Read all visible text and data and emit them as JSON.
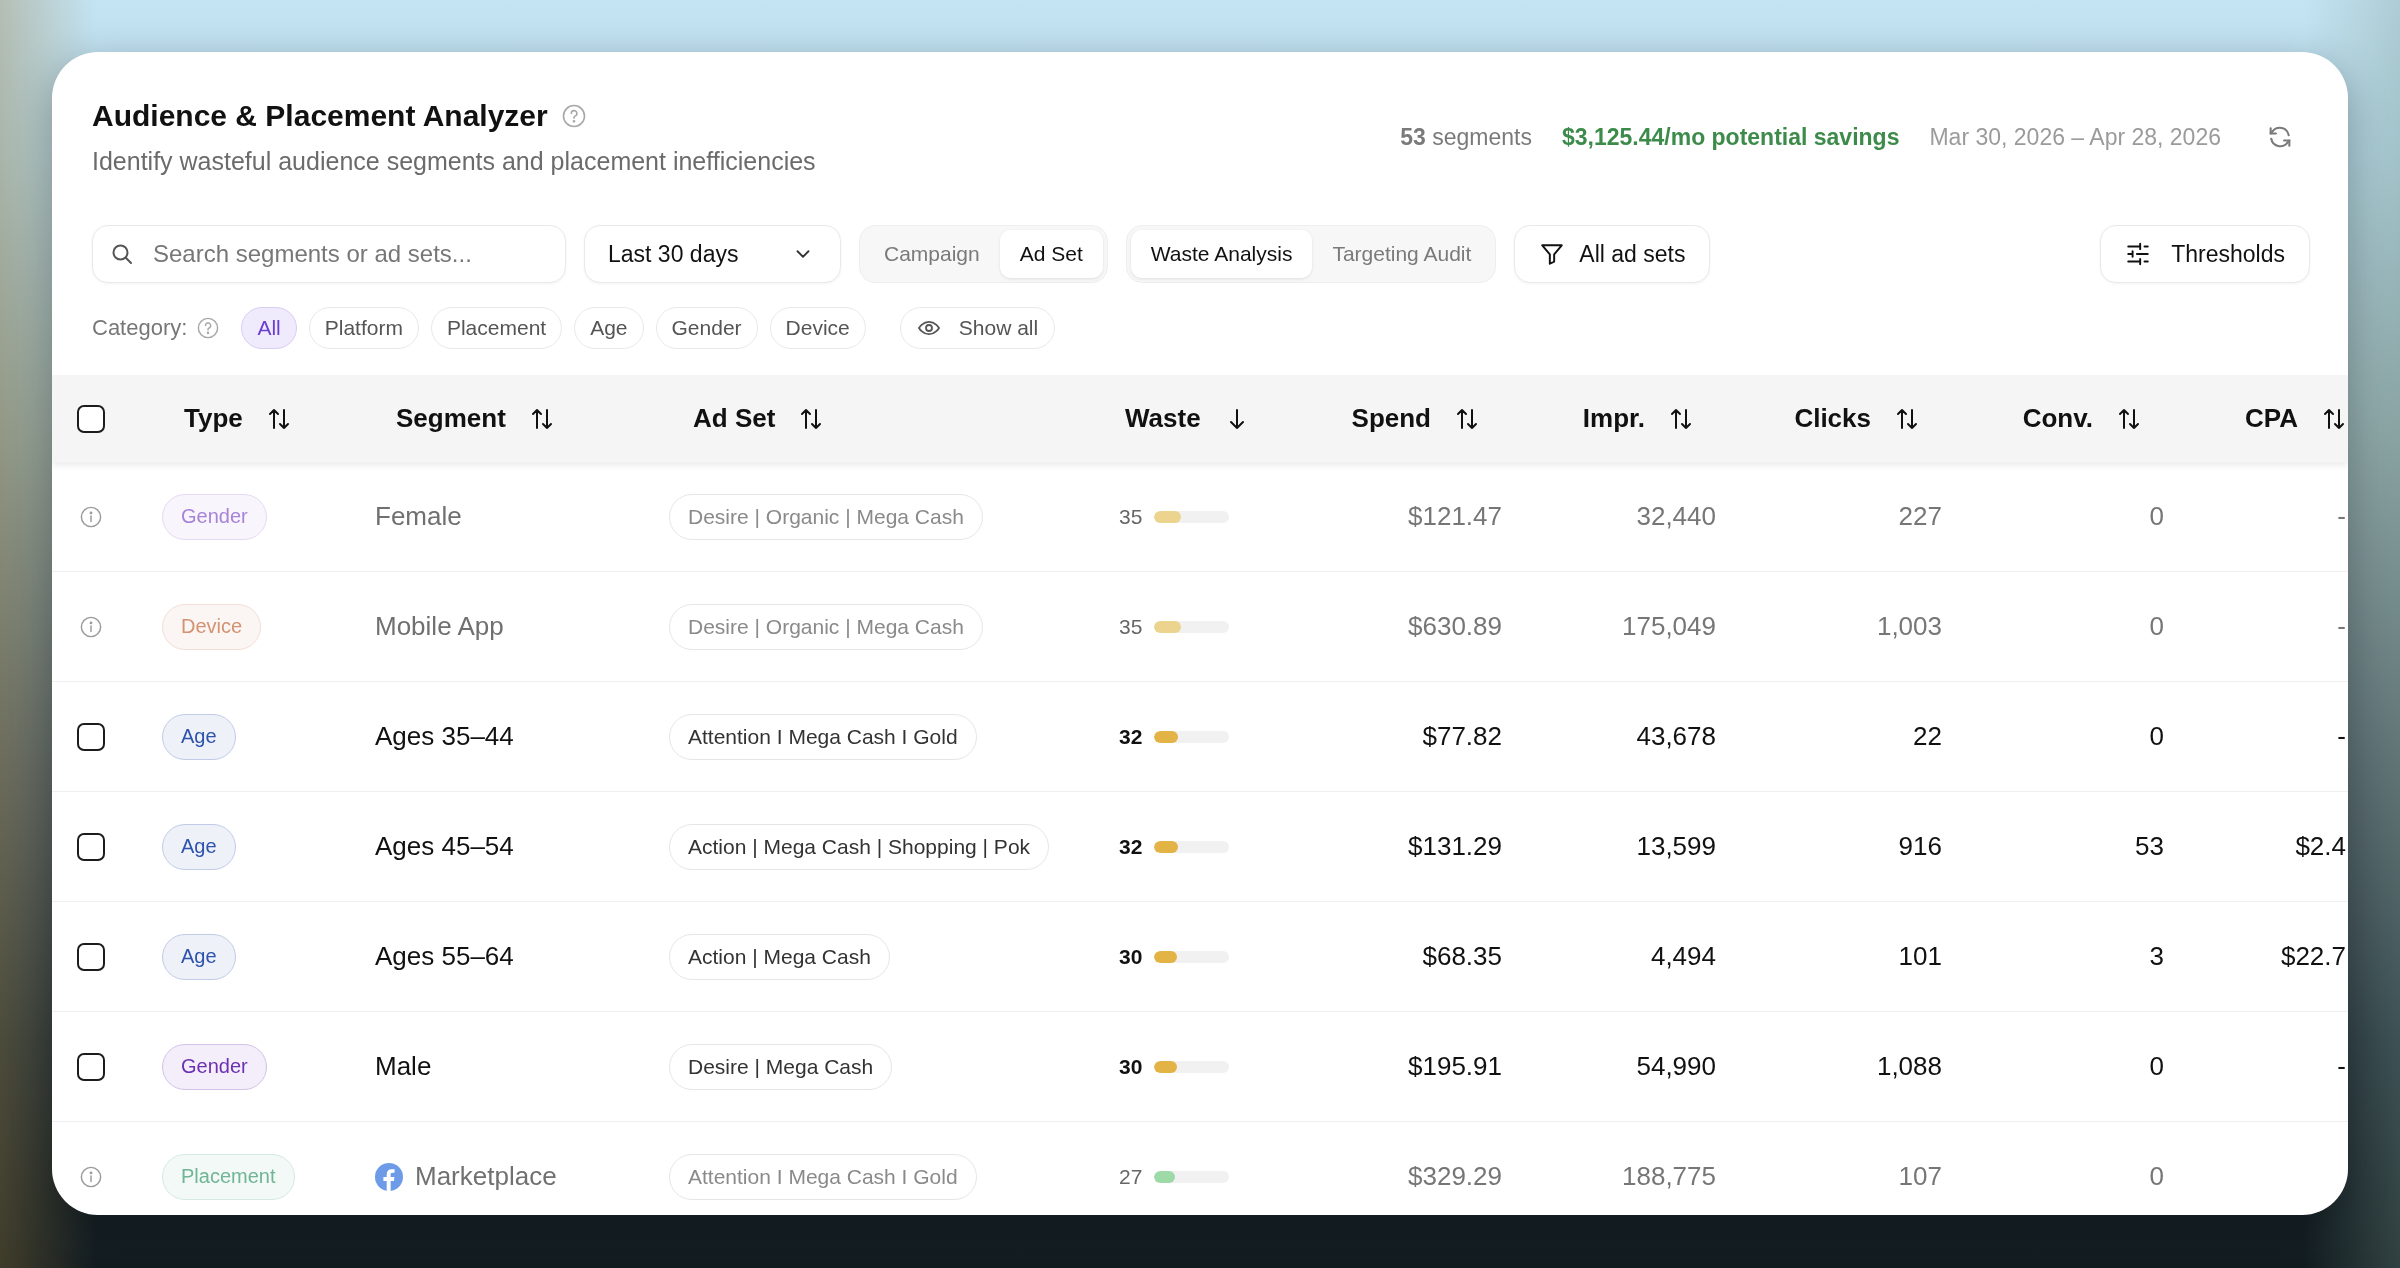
{
  "header": {
    "title": "Audience & Placement Analyzer",
    "subtitle": "Identify wasteful audience segments and placement inefficiencies",
    "segments": "**53** segments",
    "savings": "$3,125.44/mo potential savings",
    "date_range": "Mar 30, 2026 – Apr 28, 2026"
  },
  "toolbar": {
    "search": {
      "placeholder": "Search segments or ad sets..."
    },
    "period": "Last 30 days",
    "level_toggle": [
      {
        "label": "Campaign",
        "selected": false
      },
      {
        "label": "Ad Set",
        "selected": true
      }
    ],
    "view_toggle": [
      {
        "label": "Waste Analysis",
        "selected": true
      },
      {
        "label": "Targeting Audit",
        "selected": false
      }
    ],
    "filter_button": "All ad sets",
    "thresholds_button": "Thresholds"
  },
  "categories": {
    "label": "Category:",
    "chips": [
      {
        "label": "All",
        "selected": true
      },
      {
        "label": "Platform",
        "selected": false
      },
      {
        "label": "Placement",
        "selected": false
      },
      {
        "label": "Age",
        "selected": false
      },
      {
        "label": "Gender",
        "selected": false
      },
      {
        "label": "Device",
        "selected": false
      }
    ],
    "show_all": "Show all"
  },
  "table": {
    "header_checkbox": {
      "checked": false
    },
    "columns": [
      {
        "label": "Type",
        "sorted": false
      },
      {
        "label": "Segment",
        "sorted": false
      },
      {
        "label": "Ad Set",
        "sorted": false
      },
      {
        "label": "Waste",
        "sorted": true
      },
      {
        "label": "Spend",
        "sorted": false
      },
      {
        "label": "Impr.",
        "sorted": false
      },
      {
        "label": "Clicks",
        "sorted": false
      },
      {
        "label": "Conv.",
        "sorted": false
      },
      {
        "label": "CPA",
        "sorted": false
      }
    ],
    "rows": [
      {
        "kind": "info",
        "muted": true,
        "type": {
          "label": "Gender",
          "color": "#a783d8"
        },
        "segment": "Female",
        "platform_icon": false,
        "ad_set": "Desire | Organic | Mega Cash",
        "waste": {
          "score": "35",
          "level": 0.35,
          "color": "#ecd48f"
        },
        "spend": "$121.47",
        "impressions": "32,440",
        "clicks": "227",
        "conversions": "0",
        "cpa": "-"
      },
      {
        "kind": "info",
        "muted": true,
        "type": {
          "label": "Device",
          "color": "#d39272"
        },
        "segment": "Mobile App",
        "platform_icon": false,
        "ad_set": "Desire | Organic | Mega Cash",
        "waste": {
          "score": "35",
          "level": 0.35,
          "color": "#ecd48f"
        },
        "spend": "$630.89",
        "impressions": "175,049",
        "clicks": "1,003",
        "conversions": "0",
        "cpa": "-"
      },
      {
        "kind": "checkbox",
        "checked": false,
        "muted": false,
        "type": {
          "label": "Age",
          "color": "#2e53ad"
        },
        "segment": "Ages 35–44",
        "platform_icon": false,
        "ad_set": "Attention I Mega Cash I Gold",
        "waste": {
          "score": "32",
          "level": 0.32,
          "color": "#e3b445"
        },
        "spend": "$77.82",
        "impressions": "43,678",
        "clicks": "22",
        "conversions": "0",
        "cpa": "-"
      },
      {
        "kind": "checkbox",
        "checked": false,
        "muted": false,
        "type": {
          "label": "Age",
          "color": "#2e53ad"
        },
        "segment": "Ages 45–54",
        "platform_icon": false,
        "ad_set": "Action | Mega Cash | Shopping | Pok",
        "waste": {
          "score": "32",
          "level": 0.32,
          "color": "#e3b445"
        },
        "spend": "$131.29",
        "impressions": "13,599",
        "clicks": "916",
        "conversions": "53",
        "cpa": "$2.4"
      },
      {
        "kind": "checkbox",
        "checked": false,
        "muted": false,
        "type": {
          "label": "Age",
          "color": "#2e53ad"
        },
        "segment": "Ages 55–64",
        "platform_icon": false,
        "ad_set": "Action | Mega Cash",
        "waste": {
          "score": "30",
          "level": 0.3,
          "color": "#e3b445"
        },
        "spend": "$68.35",
        "impressions": "4,494",
        "clicks": "101",
        "conversions": "3",
        "cpa": "$22.7"
      },
      {
        "kind": "checkbox",
        "checked": false,
        "muted": false,
        "type": {
          "label": "Gender",
          "color": "#6b30b3"
        },
        "segment": "Male",
        "platform_icon": false,
        "ad_set": "Desire | Mega Cash",
        "waste": {
          "score": "30",
          "level": 0.3,
          "color": "#e3b445"
        },
        "spend": "$195.91",
        "impressions": "54,990",
        "clicks": "1,088",
        "conversions": "0",
        "cpa": "-"
      },
      {
        "kind": "info",
        "muted": true,
        "type": {
          "label": "Placement",
          "color": "#6fb596"
        },
        "segment": "Marketplace",
        "platform_icon": true,
        "ad_set": "Attention I Mega Cash I Gold",
        "waste": {
          "score": "27",
          "level": 0.27,
          "color": "#9edaa8"
        },
        "spend": "$329.29",
        "impressions": "188,775",
        "clicks": "107",
        "conversions": "0"
      }
    ]
  }
}
